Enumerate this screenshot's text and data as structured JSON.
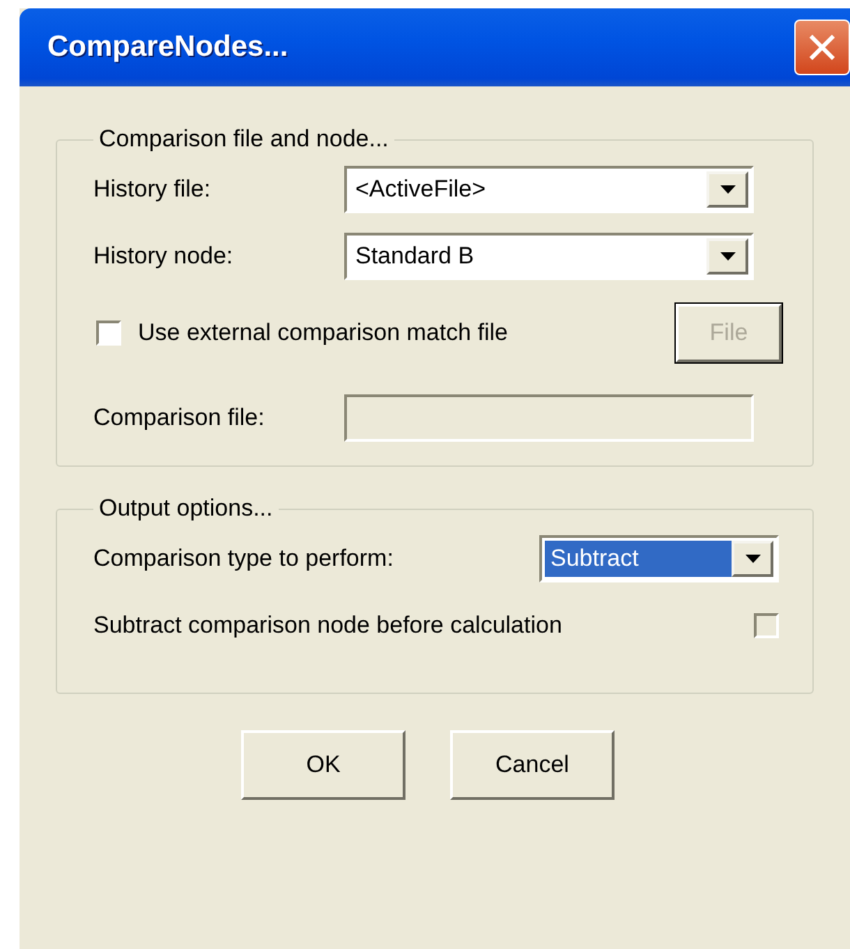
{
  "window": {
    "title": "CompareNodes..."
  },
  "groups": [
    {
      "legend": "Comparison file and node...",
      "rows": [
        {
          "kind": "combo",
          "label": "History file:",
          "value": "<ActiveFile>",
          "highlighted": false
        },
        {
          "kind": "combo",
          "label": "History node:",
          "value": "Standard B",
          "highlighted": false
        },
        {
          "kind": "check_button",
          "label": "Use external comparison match file",
          "checked": false,
          "disabled": false,
          "button": {
            "label": "File",
            "disabled": true
          }
        },
        {
          "kind": "field",
          "label": "Comparison file:",
          "disabled": true
        }
      ]
    },
    {
      "legend": "Output options...",
      "rows": [
        {
          "kind": "combo_short",
          "label": "Comparison type to perform:",
          "value": "Subtract",
          "highlighted": true
        },
        {
          "kind": "check_right",
          "label": "Subtract comparison node before calculation",
          "checked": false,
          "disabled": true
        }
      ]
    }
  ],
  "buttons": [
    {
      "label": "OK"
    },
    {
      "label": "Cancel"
    }
  ]
}
